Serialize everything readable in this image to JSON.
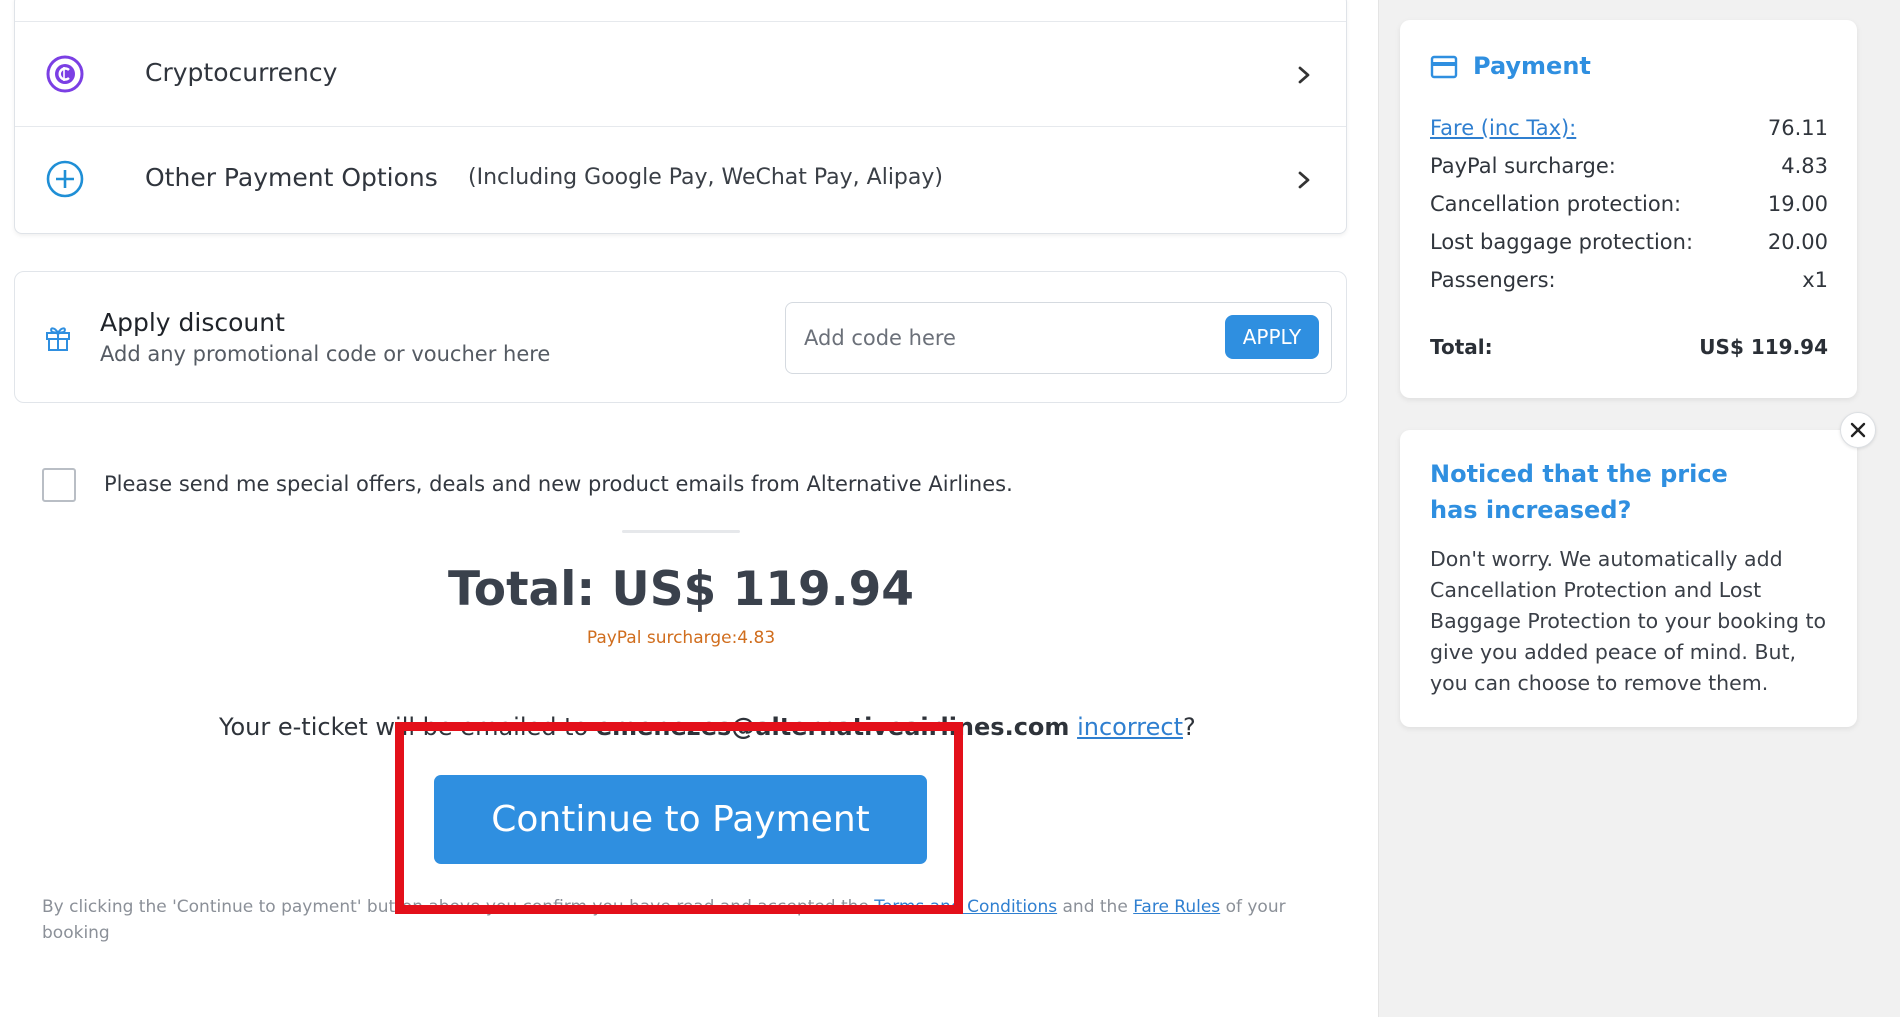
{
  "payment_methods": [
    {
      "label": "Cryptocurrency",
      "sublabel": "",
      "icon": "cryptocurrency-icon"
    },
    {
      "label": "Other Payment Options",
      "sublabel": "(Including Google Pay, WeChat Pay, Alipay)",
      "icon": "plus-circle-icon"
    }
  ],
  "discount": {
    "title": "Apply discount",
    "subtitle": "Add any promotional code or voucher here",
    "placeholder": "Add code here",
    "value": "",
    "apply_label": "APPLY"
  },
  "optin": {
    "label": "Please send me special offers, deals and new product emails from Alternative Airlines.",
    "checked": false
  },
  "summary": {
    "total_text": "Total: US$ 119.94",
    "surcharge_text": "PayPal surcharge:4.83"
  },
  "eticket": {
    "prefix": "Your e-ticket will be emailed to ",
    "email": "emenezes@alternativeairlines.com",
    "link_text": "incorrect",
    "suffix": "?"
  },
  "continue_label": "Continue to Payment",
  "terms": {
    "part1": "By clicking the 'Continue to payment' button above you confirm you have read and accepted the ",
    "link1": "Terms and Conditions",
    "part2": " and the ",
    "link2": "Fare Rules",
    "part3": " of your booking"
  },
  "payment_panel": {
    "title": "Payment",
    "rows": [
      {
        "label": "Fare (inc Tax):",
        "value": "76.11"
      },
      {
        "label": "PayPal surcharge:",
        "value": "4.83"
      },
      {
        "label": "Cancellation protection:",
        "value": "19.00"
      },
      {
        "label": "Lost baggage protection:",
        "value": "20.00"
      },
      {
        "label": "Passengers:",
        "value": "x1"
      }
    ],
    "total_label": "Total:",
    "total_value": "US$ 119.94"
  },
  "notice": {
    "title": "Noticed that the price has increased?",
    "body": "Don't worry. We automatically add Cancellation Protection and Lost Baggage Protection to your booking to give you added peace of mind. But, you can choose to remove them."
  },
  "colors": {
    "accent": "#2f8fe0",
    "highlight": "#e3101a",
    "surcharge": "#d06d1d",
    "crypto": "#7b3fe4"
  }
}
